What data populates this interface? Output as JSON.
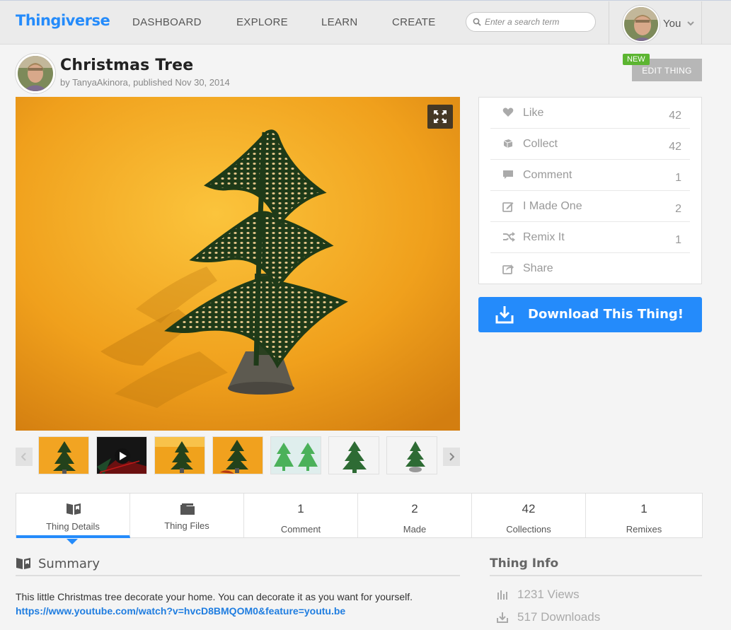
{
  "header": {
    "logo": "Thingiverse",
    "nav": [
      "DASHBOARD",
      "EXPLORE",
      "LEARN",
      "CREATE"
    ],
    "search_placeholder": "Enter a search term",
    "user_label": "You"
  },
  "thing": {
    "title": "Christmas Tree",
    "byline": "by TanyaAkinora, published Nov 30, 2014",
    "new_badge": "NEW",
    "edit_label": "EDIT THING"
  },
  "stats": [
    {
      "label": "Like",
      "count": "42",
      "icon": "heart-icon"
    },
    {
      "label": "Collect",
      "count": "42",
      "icon": "collect-icon"
    },
    {
      "label": "Comment",
      "count": "1",
      "icon": "comment-icon"
    },
    {
      "label": "I Made One",
      "count": "2",
      "icon": "made-one-icon"
    },
    {
      "label": "Remix It",
      "count": "1",
      "icon": "remix-icon"
    },
    {
      "label": "Share",
      "count": "",
      "icon": "share-icon"
    }
  ],
  "download_label": "Download This Thing!",
  "tabs": [
    {
      "label": "Thing Details",
      "count": "",
      "icon": "thing-details-icon"
    },
    {
      "label": "Thing Files",
      "count": "",
      "icon": "folder-icon"
    },
    {
      "label": "Comment",
      "count": "1"
    },
    {
      "label": "Made",
      "count": "2"
    },
    {
      "label": "Collections",
      "count": "42"
    },
    {
      "label": "Remixes",
      "count": "1"
    }
  ],
  "summary": {
    "title": "Summary",
    "text": "This little Christmas tree decorate your home. You can decorate it as you want for yourself.",
    "link": "https://www.youtube.com/watch?v=hvcD8BMQOM0&feature=youtu.be"
  },
  "thing_info": {
    "title": "Thing Info",
    "views": "1231 Views",
    "downloads": "517 Downloads"
  },
  "colors": {
    "brand": "#248bfb",
    "new_badge": "#5cb531",
    "link": "#1f7de0"
  }
}
